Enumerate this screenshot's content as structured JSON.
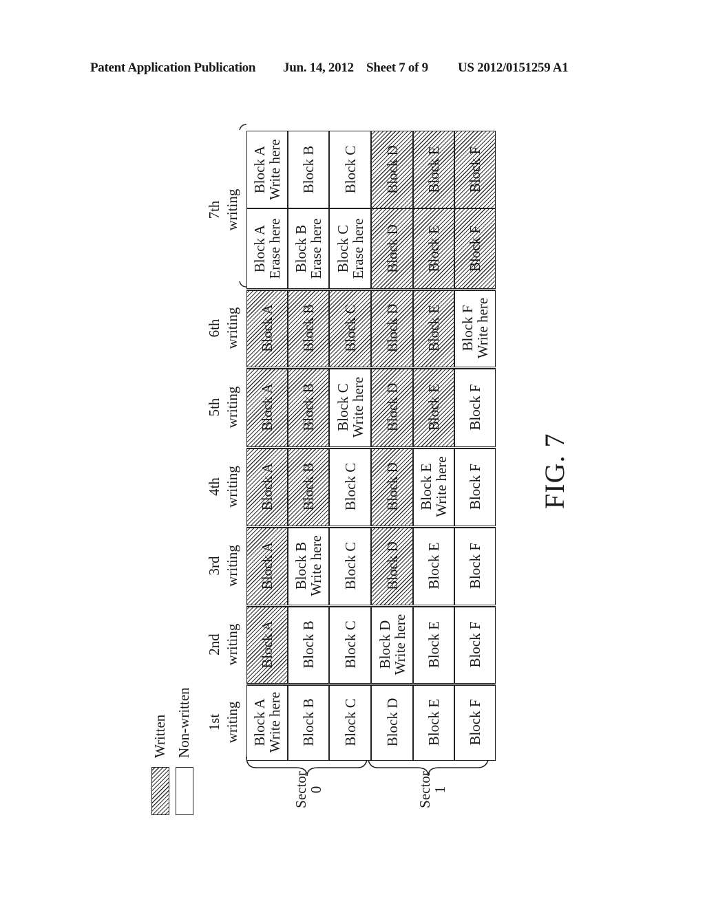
{
  "header": {
    "left": "Patent Application Publication",
    "date": "Jun. 14, 2012",
    "sheet": "Sheet 7 of 9",
    "number": "US 2012/0151259 A1"
  },
  "legend": {
    "written": "Written",
    "non_written": "Non-written"
  },
  "sectors": [
    {
      "label_line1": "Sector",
      "label_line2": "0",
      "blocks": [
        "A",
        "B",
        "C"
      ]
    },
    {
      "label_line1": "Sector",
      "label_line2": "1",
      "blocks": [
        "D",
        "E",
        "F"
      ]
    }
  ],
  "stages": [
    {
      "line1": "1st",
      "line2": "writing",
      "columns": [
        [
          {
            "label": "Block A",
            "note": "Write here",
            "written": false
          },
          {
            "label": "Block B",
            "note": "",
            "written": false
          },
          {
            "label": "Block C",
            "note": "",
            "written": false
          },
          {
            "label": "Block D",
            "note": "",
            "written": false
          },
          {
            "label": "Block E",
            "note": "",
            "written": false
          },
          {
            "label": "Block F",
            "note": "",
            "written": false
          }
        ]
      ]
    },
    {
      "line1": "2nd",
      "line2": "writing",
      "columns": [
        [
          {
            "label": "Block A",
            "note": "",
            "written": true
          },
          {
            "label": "Block B",
            "note": "",
            "written": false
          },
          {
            "label": "Block C",
            "note": "",
            "written": false
          },
          {
            "label": "Block D",
            "note": "Write here",
            "written": false
          },
          {
            "label": "Block E",
            "note": "",
            "written": false
          },
          {
            "label": "Block F",
            "note": "",
            "written": false
          }
        ]
      ]
    },
    {
      "line1": "3rd",
      "line2": "writing",
      "columns": [
        [
          {
            "label": "Block A",
            "note": "",
            "written": true
          },
          {
            "label": "Block B",
            "note": "Write here",
            "written": false
          },
          {
            "label": "Block C",
            "note": "",
            "written": false
          },
          {
            "label": "Block D",
            "note": "",
            "written": true
          },
          {
            "label": "Block E",
            "note": "",
            "written": false
          },
          {
            "label": "Block F",
            "note": "",
            "written": false
          }
        ]
      ]
    },
    {
      "line1": "4th",
      "line2": "writing",
      "columns": [
        [
          {
            "label": "Block A",
            "note": "",
            "written": true
          },
          {
            "label": "Block B",
            "note": "",
            "written": true
          },
          {
            "label": "Block C",
            "note": "",
            "written": false
          },
          {
            "label": "Block D",
            "note": "",
            "written": true
          },
          {
            "label": "Block E",
            "note": "Write here",
            "written": false
          },
          {
            "label": "Block F",
            "note": "",
            "written": false
          }
        ]
      ]
    },
    {
      "line1": "5th",
      "line2": "writing",
      "columns": [
        [
          {
            "label": "Block A",
            "note": "",
            "written": true
          },
          {
            "label": "Block B",
            "note": "",
            "written": true
          },
          {
            "label": "Block C",
            "note": "Write here",
            "written": false
          },
          {
            "label": "Block D",
            "note": "",
            "written": true
          },
          {
            "label": "Block E",
            "note": "",
            "written": true
          },
          {
            "label": "Block F",
            "note": "",
            "written": false
          }
        ]
      ]
    },
    {
      "line1": "6th",
      "line2": "writing",
      "columns": [
        [
          {
            "label": "Block A",
            "note": "",
            "written": true
          },
          {
            "label": "Block B",
            "note": "",
            "written": true
          },
          {
            "label": "Block C",
            "note": "",
            "written": true
          },
          {
            "label": "Block D",
            "note": "",
            "written": true
          },
          {
            "label": "Block E",
            "note": "",
            "written": true
          },
          {
            "label": "Block F",
            "note": "Write here",
            "written": false
          }
        ]
      ]
    },
    {
      "line1": "7th",
      "line2": "writing",
      "columns": [
        [
          {
            "label": "Block A",
            "note": "Erase here",
            "written": false
          },
          {
            "label": "Block B",
            "note": "Erase here",
            "written": false
          },
          {
            "label": "Block C",
            "note": "Erase here",
            "written": false
          },
          {
            "label": "Block D",
            "note": "",
            "written": true
          },
          {
            "label": "Block E",
            "note": "",
            "written": true
          },
          {
            "label": "Block F",
            "note": "",
            "written": true
          }
        ],
        [
          {
            "label": "Block A",
            "note": "Write here",
            "written": false
          },
          {
            "label": "Block B",
            "note": "",
            "written": false
          },
          {
            "label": "Block C",
            "note": "",
            "written": false
          },
          {
            "label": "Block D",
            "note": "",
            "written": true
          },
          {
            "label": "Block E",
            "note": "",
            "written": true
          },
          {
            "label": "Block F",
            "note": "",
            "written": true
          }
        ]
      ]
    }
  ],
  "figure_label": "FIG. 7"
}
